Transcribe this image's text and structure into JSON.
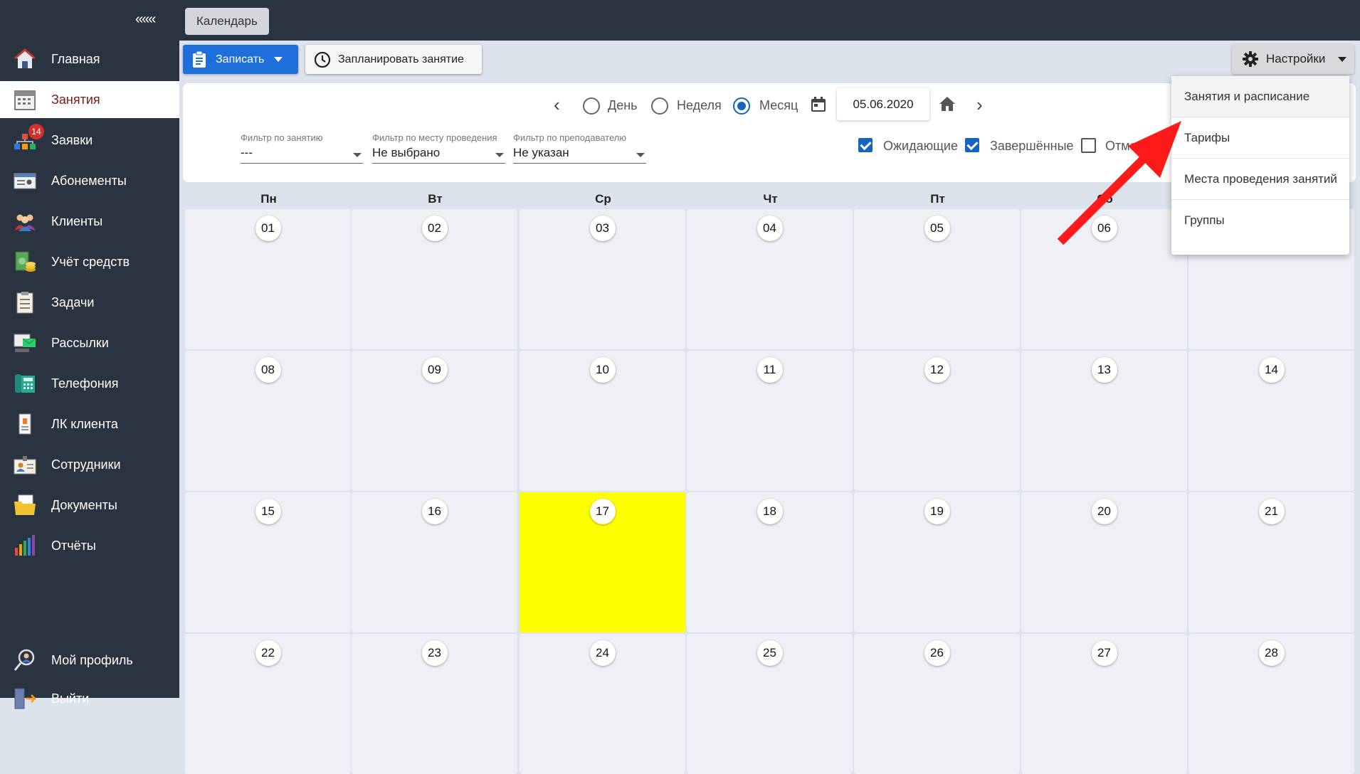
{
  "topbar": {
    "collapse": "«««",
    "page_tab": "Календарь"
  },
  "sidebar": {
    "items": [
      {
        "label": "Главная",
        "icon": "home-icon"
      },
      {
        "label": "Занятия",
        "icon": "calendar-icon",
        "active": true
      },
      {
        "label": "Заявки",
        "icon": "requests-icon",
        "badge": "14"
      },
      {
        "label": "Абонементы",
        "icon": "subscription-icon"
      },
      {
        "label": "Клиенты",
        "icon": "clients-icon"
      },
      {
        "label": "Учёт средств",
        "icon": "money-icon"
      },
      {
        "label": "Задачи",
        "icon": "tasks-icon"
      },
      {
        "label": "Рассылки",
        "icon": "mailing-icon"
      },
      {
        "label": "Телефония",
        "icon": "phone-icon"
      },
      {
        "label": "ЛК клиента",
        "icon": "client-cabinet-icon"
      },
      {
        "label": "Сотрудники",
        "icon": "staff-icon"
      },
      {
        "label": "Документы",
        "icon": "documents-icon"
      },
      {
        "label": "Отчёты",
        "icon": "reports-icon"
      }
    ],
    "bottom": [
      {
        "label": "Мой профиль",
        "icon": "profile-icon"
      },
      {
        "label": "Выйти",
        "icon": "logout-icon"
      }
    ]
  },
  "toolbar": {
    "record_label": "Записать",
    "plan_label": "Запланировать занятие",
    "settings_label": "Настройки"
  },
  "view": {
    "day_label": "День",
    "week_label": "Неделя",
    "month_label": "Месяц",
    "selected": "month",
    "date_value": "05.06.2020"
  },
  "filters": {
    "lesson_label": "Фильтр по занятию",
    "lesson_value": "---",
    "place_label": "Фильтр по месту проведения",
    "place_value": "Не выбрано",
    "teacher_label": "Фильтр по преподавателю",
    "teacher_value": "Не указан"
  },
  "status_filters": {
    "pending_label": "Ожидающие",
    "completed_label": "Завершённые",
    "cancelled_label": "Отмен"
  },
  "calendar": {
    "weekdays": [
      "Пн",
      "Вт",
      "Ср",
      "Чт",
      "Пт",
      "Сб",
      ""
    ],
    "weeks": [
      [
        "01",
        "02",
        "03",
        "04",
        "05",
        "06",
        ""
      ],
      [
        "08",
        "09",
        "10",
        "11",
        "12",
        "13",
        "14"
      ],
      [
        "15",
        "16",
        "17",
        "18",
        "19",
        "20",
        "21"
      ],
      [
        "22",
        "23",
        "24",
        "25",
        "26",
        "27",
        "28"
      ]
    ],
    "highlighted_day": "17",
    "highlight_color": "#ffff00"
  },
  "settings_menu": {
    "items": [
      "Занятия и расписание",
      "Тарифы",
      "Места проведения занятий",
      "Группы"
    ]
  },
  "colors": {
    "sidebar": "#2a3340",
    "primary": "#1e6fd9",
    "arrow": "#ff1a1a"
  }
}
